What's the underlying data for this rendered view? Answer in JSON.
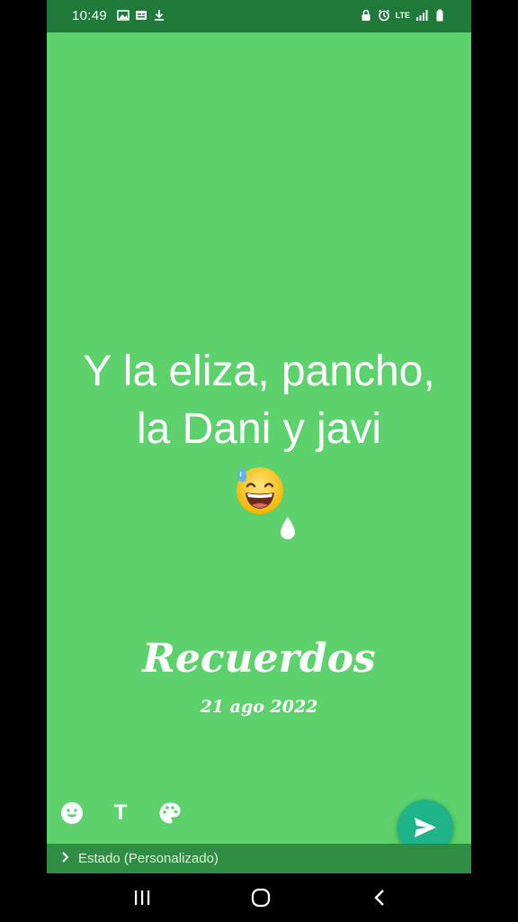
{
  "status_bar": {
    "time": "10:49",
    "network_label": "LTE",
    "left_icons": [
      "image-icon",
      "caption-icon",
      "download-icon"
    ],
    "right_icons": [
      "lock-icon",
      "alarm-icon",
      "signal-icon",
      "battery-icon"
    ]
  },
  "status_post": {
    "text_line1": "Y la eliza, pancho,",
    "text_line2": "la Dani y javi",
    "emoji": "grinning-sweat-emoji",
    "background_color": "#5cd16c",
    "title": "Recuerdos",
    "date": "21 ago 2022"
  },
  "toolbar": {
    "emoji_icon": "smiley-icon",
    "text_tool_label": "T",
    "palette_icon": "palette-icon"
  },
  "send_button": {
    "icon": "send-icon",
    "color": "#1fb38a"
  },
  "privacy": {
    "label": "Estado (Personalizado)"
  },
  "nav": {
    "icons": [
      "recent-apps-icon",
      "home-icon",
      "back-icon"
    ]
  }
}
